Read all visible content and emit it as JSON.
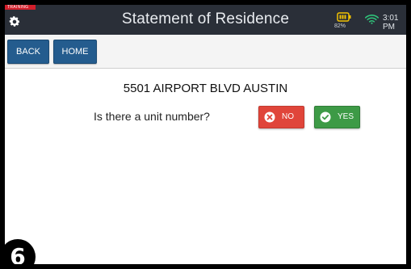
{
  "header": {
    "training_label": "TRAINING",
    "title": "Statement of Residence",
    "battery_percent": "82%",
    "time": "3:01 PM",
    "icons": [
      "gear-icon",
      "battery-icon",
      "wifi-icon"
    ]
  },
  "nav": {
    "back_label": "BACK",
    "home_label": "HOME"
  },
  "main": {
    "address": "5501 AIRPORT BLVD AUSTIN",
    "question": "Is there a unit number?",
    "no_label": "NO",
    "yes_label": "YES"
  },
  "step_marker": "6",
  "colors": {
    "topbar": "#2a2f38",
    "training_badge": "#d21f2b",
    "nav_button": "#245c8e",
    "no_button": "#e0453a",
    "yes_button": "#3d9a46",
    "wifi": "#2fc47a",
    "battery": "#f2c200"
  }
}
